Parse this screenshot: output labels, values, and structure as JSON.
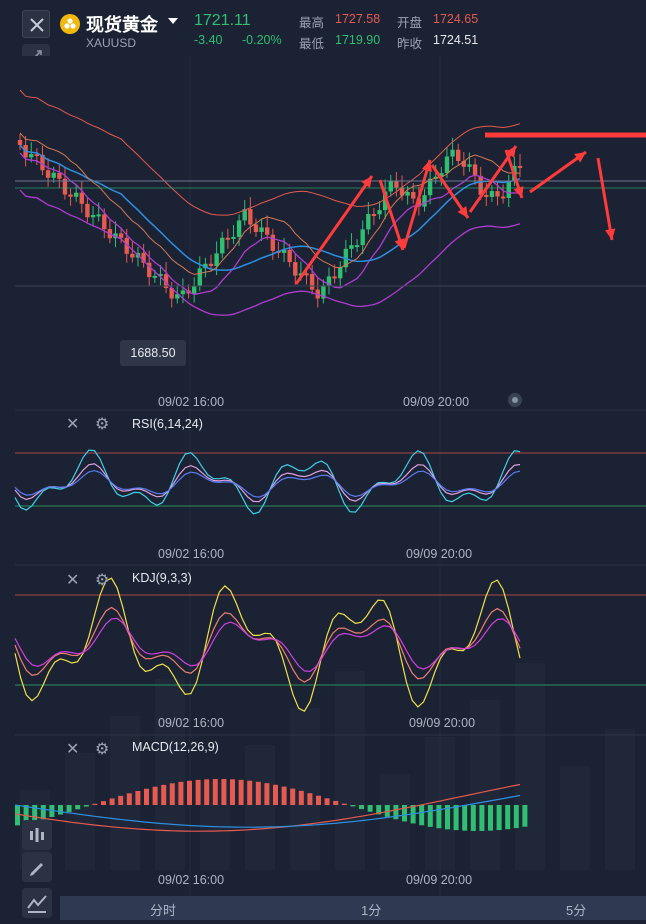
{
  "header": {
    "title": "现货黄金",
    "symbol": "XAUUSD",
    "price": "1721.11",
    "change": "-3.40",
    "change_pct": "-0.20%",
    "high_label": "最高",
    "high": "1727.58",
    "low_label": "最低",
    "low": "1719.90",
    "open_label": "开盘",
    "open": "1724.65",
    "prev_close_label": "昨收",
    "prev_close": "1724.51"
  },
  "main_chart": {
    "low_marker": "1688.50",
    "x_labels": [
      "09/02 16:00",
      "09/09 20:00"
    ]
  },
  "panels": {
    "rsi": {
      "title": "RSI(6,14,24)",
      "x_labels": [
        "09/02 16:00",
        "09/09 20:00"
      ]
    },
    "kdj": {
      "title": "KDJ(9,3,3)",
      "x_labels": [
        "09/02 16:00",
        "09/09 20:00"
      ]
    },
    "macd": {
      "title": "MACD(12,26,9)",
      "x_labels": [
        "09/02 16:00",
        "09/09 20:00"
      ]
    }
  },
  "tabs": [
    "分时",
    "1分",
    "5分"
  ],
  "colors": {
    "up": "#e65a4f",
    "down": "#2fbf71",
    "bg": "#1b2233",
    "ma_blue": "#2e8fe0",
    "boll": "#b03cd0",
    "annotation": "#ff3b3b"
  },
  "icons": [
    "close-icon",
    "drag-icon",
    "gold-coin-icon",
    "caret-down-icon",
    "settings-icon",
    "indicator-icon",
    "pencil-icon",
    "line-tool-icon"
  ]
}
